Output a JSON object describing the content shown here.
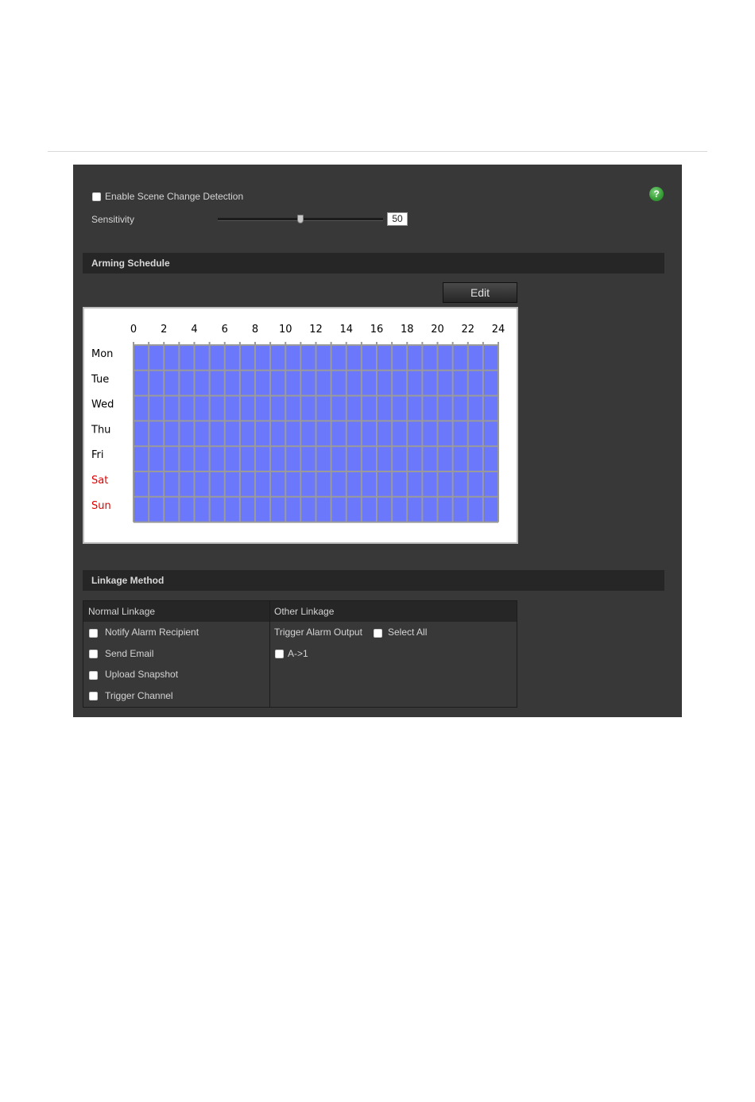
{
  "settings": {
    "enable_label": "Enable Scene Change Detection",
    "sensitivity_label": "Sensitivity",
    "sensitivity_value": "50",
    "sensitivity_level": 50
  },
  "arming": {
    "title": "Arming Schedule",
    "edit_label": "Edit",
    "hours": [
      "0",
      "2",
      "4",
      "6",
      "8",
      "10",
      "12",
      "14",
      "16",
      "18",
      "20",
      "22",
      "24"
    ],
    "days": [
      {
        "label": "Mon",
        "weekend": false
      },
      {
        "label": "Tue",
        "weekend": false
      },
      {
        "label": "Wed",
        "weekend": false
      },
      {
        "label": "Thu",
        "weekend": false
      },
      {
        "label": "Fri",
        "weekend": false
      },
      {
        "label": "Sat",
        "weekend": true
      },
      {
        "label": "Sun",
        "weekend": true
      }
    ],
    "colors": {
      "active": "#6b78fc",
      "weekday_text": "#000000",
      "weekend_text": "#e00000",
      "grid_line": "#9a9a9a"
    }
  },
  "linkage": {
    "title": "Linkage Method",
    "normal_header": "Normal Linkage",
    "other_header": "Other Linkage",
    "normal_items": [
      "Notify Alarm Recipient",
      "Send Email",
      "Upload Snapshot",
      "Trigger Channel"
    ],
    "trigger_alarm_output": "Trigger Alarm Output",
    "select_all": "Select All",
    "alarm_output_item": "A->1"
  },
  "icons": {
    "help": "help-icon"
  }
}
